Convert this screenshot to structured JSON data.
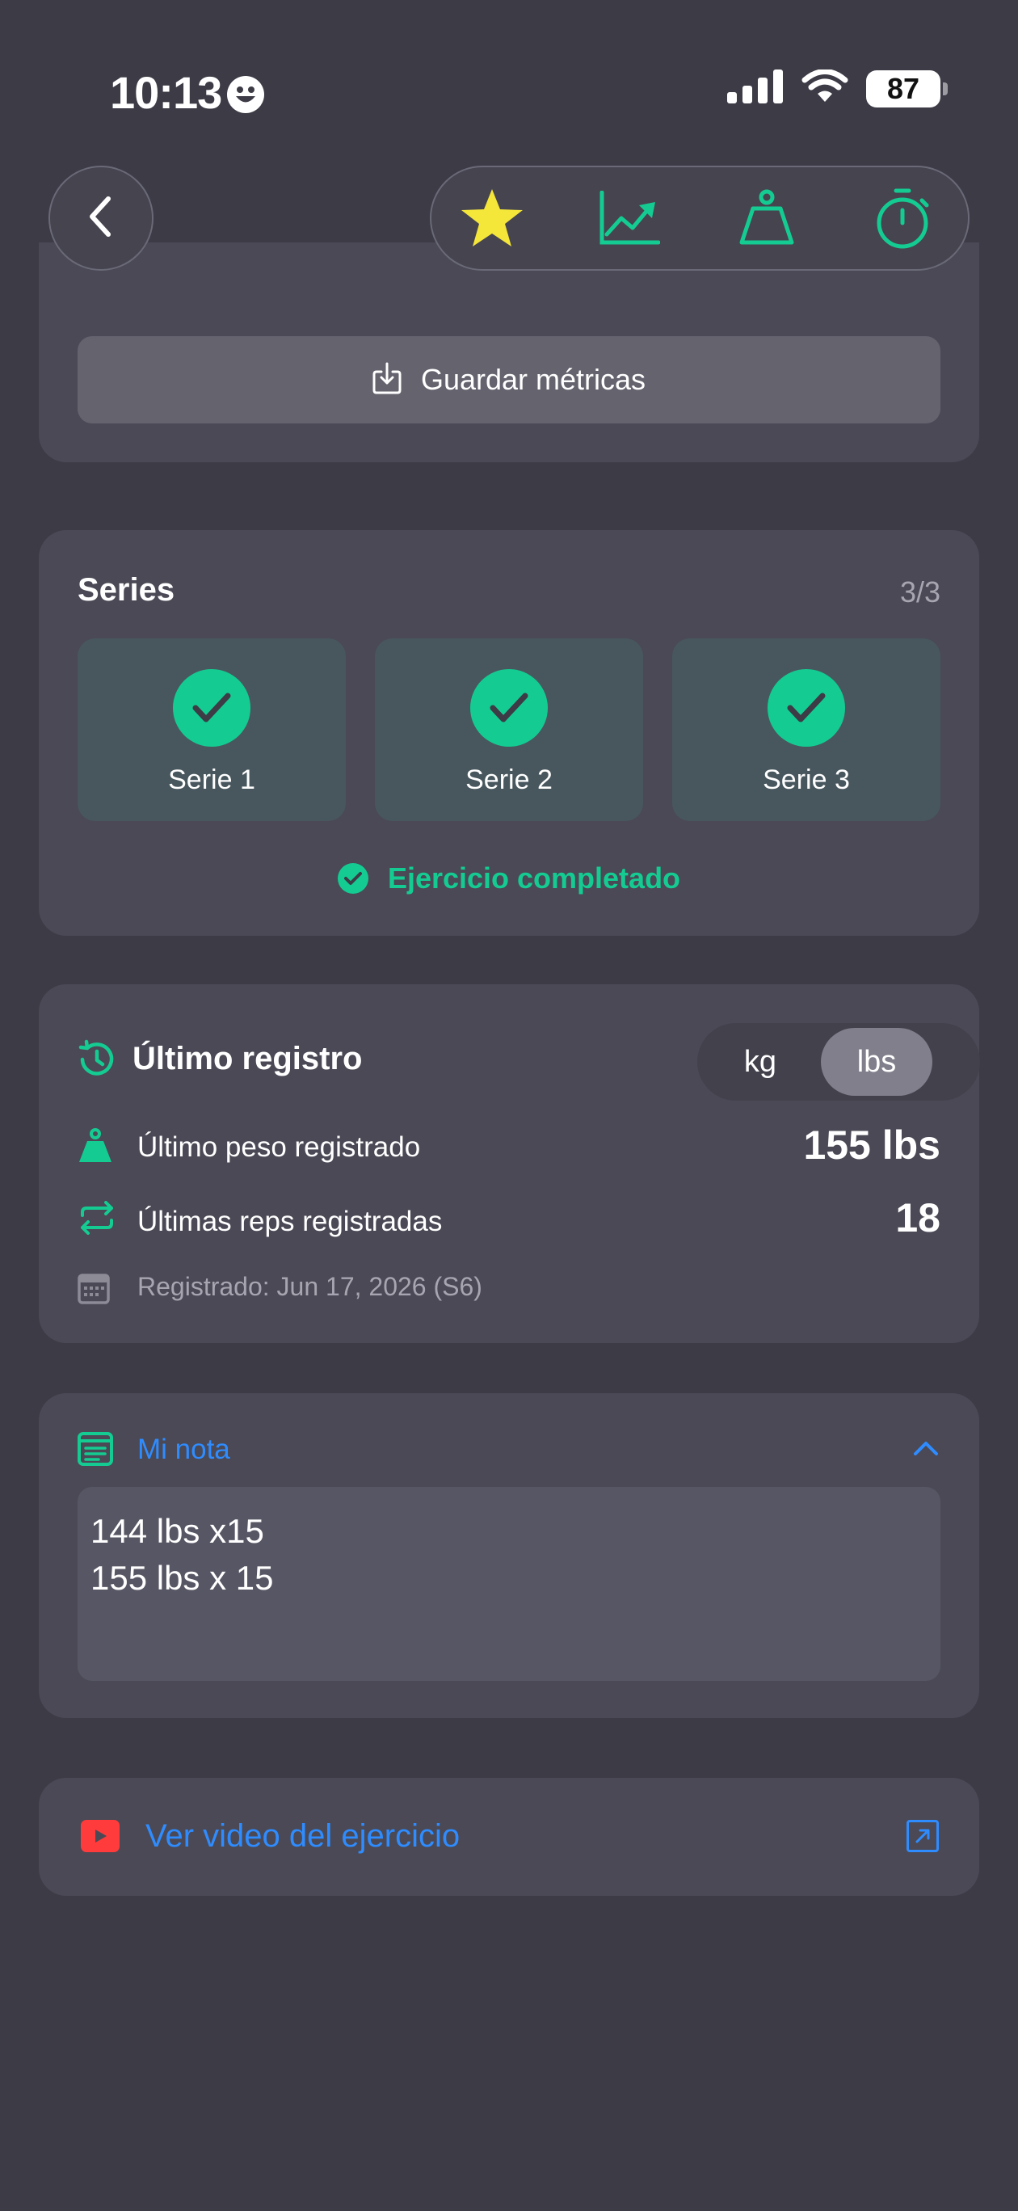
{
  "status_bar": {
    "time": "10:13",
    "battery": "87"
  },
  "toolbar": {
    "icons": [
      "star-icon",
      "chart-icon",
      "weight-icon",
      "timer-icon"
    ]
  },
  "metrics": {
    "save_label": "Guardar métricas"
  },
  "series": {
    "title": "Series",
    "count": "3/3",
    "items": [
      {
        "label": "Serie 1",
        "done": true
      },
      {
        "label": "Serie 2",
        "done": true
      },
      {
        "label": "Serie 3",
        "done": true
      }
    ],
    "completed_label": "Ejercicio completado"
  },
  "last_record": {
    "title": "Último registro",
    "units": {
      "kg": "kg",
      "lbs": "lbs",
      "selected": "lbs"
    },
    "weight_label": "Último peso registrado",
    "weight_value": "155 lbs",
    "reps_label": "Últimas reps registradas",
    "reps_value": "18",
    "date_label": "Registrado: Jun 17, 2026 (S6)"
  },
  "note": {
    "title": "Mi nota",
    "lines": [
      "144 lbs x15",
      "155 lbs x 15"
    ]
  },
  "video": {
    "label": "Ver video del ejercicio"
  },
  "colors": {
    "background": "#3c3b46",
    "card": "#4a4955",
    "accent_green": "#14cc92",
    "link_blue": "#2f8cff",
    "star_yellow": "#f5e63a",
    "youtube_red": "#ff3b3b"
  }
}
